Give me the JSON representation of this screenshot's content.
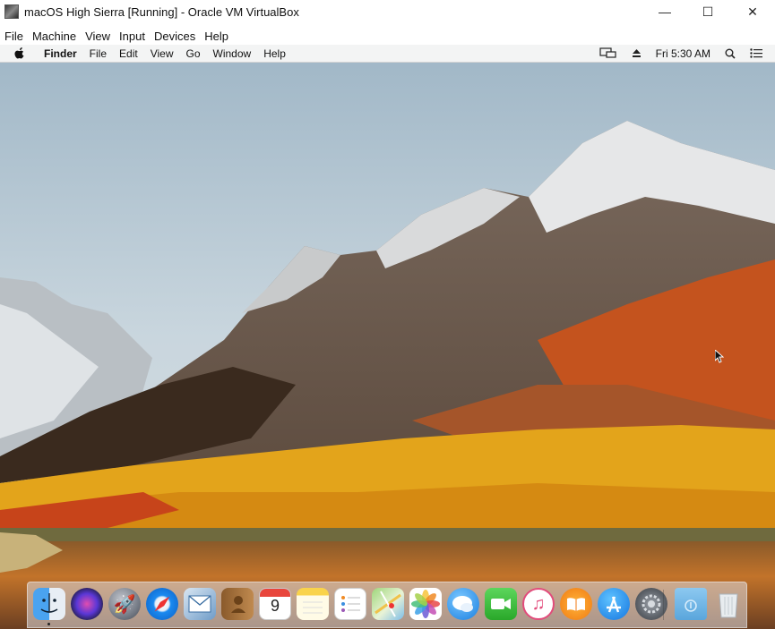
{
  "window": {
    "title": "macOS High Sierra [Running] - Oracle VM VirtualBox",
    "controls": {
      "minimize": "—",
      "maximize": "☐",
      "close": "✕"
    }
  },
  "host_menu": [
    "File",
    "Machine",
    "View",
    "Input",
    "Devices",
    "Help"
  ],
  "guest_menubar": {
    "app_name": "Finder",
    "items": [
      "File",
      "Edit",
      "View",
      "Go",
      "Window",
      "Help"
    ],
    "clock": "Fri 5:30 AM"
  },
  "dock": {
    "items": [
      "finder-icon",
      "siri-icon",
      "launchpad-icon",
      "safari-icon",
      "mail-icon",
      "contacts-icon",
      "calendar-icon",
      "notes-icon",
      "reminders-icon",
      "maps-icon",
      "photos-icon",
      "messages-icon",
      "facetime-icon",
      "itunes-icon",
      "ibooks-icon",
      "app-store-icon",
      "system-preferences-icon",
      "downloads-folder-icon",
      "trash-icon"
    ],
    "calendar_day": "9"
  }
}
